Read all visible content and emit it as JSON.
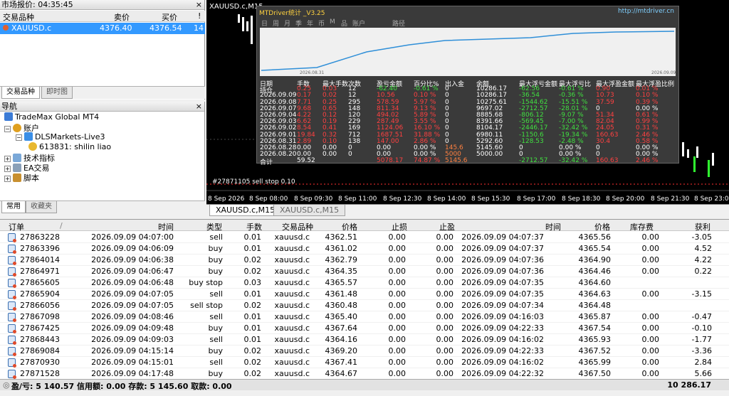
{
  "market_watch": {
    "title": "市场报价: 04:35:45",
    "close": "×",
    "columns": [
      "交易品种",
      "卖价",
      "买价",
      "!"
    ],
    "rows": [
      {
        "symbol": "XAUUSD.c",
        "bid": "4376.40",
        "ask": "4376.54",
        "spread": "14"
      }
    ],
    "tabs": [
      "交易品种",
      "即时图"
    ]
  },
  "navigator": {
    "title": "导航",
    "close": "×",
    "items": [
      "TradeMax Global MT4",
      "账户",
      "DLSMarkets-Live3",
      "613831: shilin liao",
      "技术指标",
      "EA交易",
      "脚本"
    ],
    "tabs": [
      "常用",
      "收藏夹"
    ]
  },
  "chart": {
    "title": "XAUUSD.c,M15",
    "x_ticks": [
      "8 Sep 2026",
      "8 Sep 08:00",
      "8 Sep 09:30",
      "8 Sep 11:00",
      "8 Sep 12:30",
      "8 Sep 14:00",
      "8 Sep 15:30",
      "8 Sep 17:00",
      "8 Sep 18:30",
      "8 Sep 20:00",
      "8 Sep 21:30",
      "8 Sep 23:00"
    ],
    "bg_labels": [
      "#27871105 sell stop 0.10"
    ],
    "tabs": [
      "XAUUSD.c,M15",
      "XAUUSD.c,M15"
    ]
  },
  "mtdriver": {
    "title": "MTDriver统计 _V3.25",
    "url": "http://mtdriver.cn",
    "toolbar": [
      "日",
      "周",
      "月",
      "季",
      "年",
      "币",
      "M",
      "品",
      "账户",
      "路径"
    ],
    "graph_start": "2026.08.31",
    "graph_end": "2026.09.09",
    "headers": [
      "日期",
      "手数",
      "最大手数",
      "次数",
      "盈亏金额",
      "百分比%",
      "出入金",
      "余额",
      "最大浮亏金额",
      "最大浮亏比",
      "最大浮盈金额",
      "最大浮盈比例"
    ],
    "rows": [
      [
        "持仓",
        "0.25",
        "0.03",
        "12",
        "-62.40",
        "-0.61 %",
        "0",
        "10286.17",
        "-62.56",
        "-0.61 %",
        "0.90",
        "0.01 %"
      ],
      [
        "2026.09.09",
        "0.17",
        "0.02",
        "12",
        "10.56",
        "0.10 %",
        "0",
        "10286.17",
        "-36.54",
        "-0.36 %",
        "10.73",
        "0.10 %"
      ],
      [
        "2026.09.08",
        "7.71",
        "0.25",
        "295",
        "578.59",
        "5.97 %",
        "0",
        "10275.61",
        "-1544.62",
        "-15.51 %",
        "37.59",
        "0.39 %"
      ],
      [
        "2026.09.07",
        "9.68",
        "0.65",
        "148",
        "811.34",
        "9.13 %",
        "0",
        "9697.02",
        "-2712.57",
        "-28.01 %",
        "0",
        "0.00 %"
      ],
      [
        "2026.09.04",
        "4.22",
        "0.12",
        "120",
        "494.02",
        "5.89 %",
        "0",
        "8885.68",
        "-806.12",
        "-9.07 %",
        "51.34",
        "0.61 %"
      ],
      [
        "2026.09.03",
        "6.62",
        "0.19",
        "229",
        "287.49",
        "3.55 %",
        "0",
        "8391.66",
        "-569.45",
        "-7.00 %",
        "82.04",
        "0.99 %"
      ],
      [
        "2026.09.02",
        "8.54",
        "0.41",
        "169",
        "1124.06",
        "16.10 %",
        "0",
        "8104.17",
        "-2446.17",
        "-32.42 %",
        "24.05",
        "0.31 %"
      ],
      [
        "2026.09.01",
        "19.84",
        "0.32",
        "712",
        "1687.51",
        "31.88 %",
        "0",
        "6980.11",
        "-1150.6",
        "-19.34 %",
        "160.63",
        "2.46 %"
      ],
      [
        "2026.08.31",
        "2.89",
        "0.10",
        "138",
        "147.00",
        "2.86 %",
        "0",
        "5292.60",
        "-128.53",
        "-2.48 %",
        "30.4",
        "0.58 %"
      ],
      [
        "2026.08.28",
        "0.00",
        "0.00",
        "0",
        "0.00",
        "0.00 %",
        "145.6",
        "5145.60",
        "0",
        "0.00 %",
        "0",
        "0.00 %"
      ],
      [
        "2026.08.20",
        "0.00",
        "0.00",
        "0",
        "0.00",
        "0.00 %",
        "5000",
        "5000.00",
        "0",
        "0.00 %",
        "0",
        "0.00 %"
      ],
      [
        "合计",
        "59.52",
        "",
        "",
        "5078.17",
        "74.87 %",
        "5145.6",
        "",
        "-2712.57",
        "-32.42 %",
        "160.63",
        "2.46 %"
      ]
    ],
    "colors": {
      "positive": "#ff4040",
      "negative": "#40e040",
      "neutral": "#ffffff",
      "deposit": "#ff8040"
    }
  },
  "orders": {
    "headers": [
      "订单",
      "/",
      "时间",
      "类型",
      "手数",
      "交易品种",
      "价格",
      "止损",
      "止盈",
      "时间",
      "价格",
      "库存费",
      "获利"
    ],
    "rows": [
      [
        "27863228",
        "2026.09.09 04:07:00",
        "sell",
        "0.01",
        "xauusd.c",
        "4362.51",
        "0.00",
        "0.00",
        "2026.09.09 04:07:37",
        "4365.56",
        "0.00",
        "-3.05"
      ],
      [
        "27863396",
        "2026.09.09 04:06:09",
        "buy",
        "0.01",
        "xauusd.c",
        "4361.02",
        "0.00",
        "0.00",
        "2026.09.09 04:07:37",
        "4365.54",
        "0.00",
        "4.52"
      ],
      [
        "27864014",
        "2026.09.09 04:06:38",
        "buy",
        "0.02",
        "xauusd.c",
        "4362.79",
        "0.00",
        "0.00",
        "2026.09.09 04:07:36",
        "4364.90",
        "0.00",
        "4.22"
      ],
      [
        "27864971",
        "2026.09.09 04:06:47",
        "buy",
        "0.02",
        "xauusd.c",
        "4364.35",
        "0.00",
        "0.00",
        "2026.09.09 04:07:36",
        "4364.46",
        "0.00",
        "0.22"
      ],
      [
        "27865605",
        "2026.09.09 04:06:48",
        "buy stop",
        "0.03",
        "xauusd.c",
        "4365.57",
        "0.00",
        "0.00",
        "2026.09.09 04:07:35",
        "4364.60",
        "",
        ""
      ],
      [
        "27865904",
        "2026.09.09 04:07:05",
        "sell",
        "0.01",
        "xauusd.c",
        "4361.48",
        "0.00",
        "0.00",
        "2026.09.09 04:07:35",
        "4364.63",
        "0.00",
        "-3.15"
      ],
      [
        "27866056",
        "2026.09.09 04:07:05",
        "sell stop",
        "0.02",
        "xauusd.c",
        "4360.48",
        "0.00",
        "0.00",
        "2026.09.09 04:07:34",
        "4364.48",
        "",
        ""
      ],
      [
        "27867098",
        "2026.09.09 04:08:46",
        "sell",
        "0.01",
        "xauusd.c",
        "4365.40",
        "0.00",
        "0.00",
        "2026.09.09 04:16:03",
        "4365.87",
        "0.00",
        "-0.47"
      ],
      [
        "27867425",
        "2026.09.09 04:09:48",
        "buy",
        "0.01",
        "xauusd.c",
        "4367.64",
        "0.00",
        "0.00",
        "2026.09.09 04:22:33",
        "4367.54",
        "0.00",
        "-0.10"
      ],
      [
        "27868443",
        "2026.09.09 04:09:03",
        "sell",
        "0.01",
        "xauusd.c",
        "4364.16",
        "0.00",
        "0.00",
        "2026.09.09 04:16:02",
        "4365.93",
        "0.00",
        "-1.77"
      ],
      [
        "27869084",
        "2026.09.09 04:15:14",
        "buy",
        "0.02",
        "xauusd.c",
        "4369.20",
        "0.00",
        "0.00",
        "2026.09.09 04:22:33",
        "4367.52",
        "0.00",
        "-3.36"
      ],
      [
        "27870930",
        "2026.09.09 04:15:01",
        "sell",
        "0.02",
        "xauusd.c",
        "4367.41",
        "0.00",
        "0.00",
        "2026.09.09 04:16:02",
        "4365.99",
        "0.00",
        "2.84"
      ],
      [
        "27871528",
        "2026.09.09 04:17:48",
        "buy",
        "0.02",
        "xauusd.c",
        "4364.67",
        "0.00",
        "0.00",
        "2026.09.09 04:22:32",
        "4367.50",
        "0.00",
        "5.66"
      ]
    ],
    "footer": "盈/亏: 5 140.57  信用额: 0.00  存款: 5 145.60  取款: 0.00",
    "footer_total": "10 286.17"
  }
}
